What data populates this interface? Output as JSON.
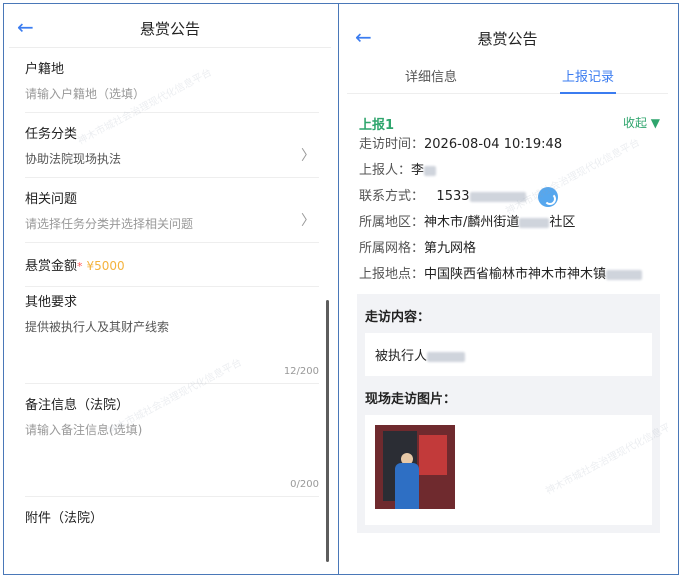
{
  "left": {
    "title": "悬赏公告",
    "fields": {
      "huji": {
        "label": "户籍地",
        "placeholder": "请输入户籍地（选填）"
      },
      "category": {
        "label": "任务分类",
        "value": "协助法院现场执法"
      },
      "issue": {
        "label": "相关问题",
        "placeholder": "请选择任务分类并选择相关问题"
      },
      "reward": {
        "label": "悬赏金额",
        "required": "*",
        "value": "¥5000"
      },
      "other": {
        "label": "其他要求",
        "value": "提供被执行人及其财产线索",
        "counter": "12/200"
      },
      "remark": {
        "label": "备注信息（法院）",
        "placeholder": "请输入备注信息(选填)",
        "counter": "0/200"
      },
      "attachment": {
        "label": "附件（法院）"
      }
    }
  },
  "right": {
    "title": "悬赏公告",
    "tabs": [
      "详细信息",
      "上报记录"
    ],
    "active_tab": 1,
    "report": {
      "title": "上报1",
      "collapse": "收起 ▼",
      "rows": [
        {
          "k": "走访时间：",
          "v": "2026-08-04 10:19:48"
        },
        {
          "k": "上报人：",
          "v": "李"
        },
        {
          "k": "联系方式：",
          "v": "1533"
        },
        {
          "k": "所属地区：",
          "v": "神木市/麟州街道",
          "v2": "社区"
        },
        {
          "k": "所属网格：",
          "v": "第九网格"
        },
        {
          "k": "上报地点：",
          "v": "中国陕西省榆林市神木市神木镇"
        }
      ],
      "visit_title": "走访内容：",
      "visit_content": "被执行人",
      "photos_title": "现场走访图片："
    }
  },
  "icons": {
    "back": "back-arrow-icon",
    "chevron": "chevron-right-icon",
    "call": "phone-call-icon"
  },
  "colors": {
    "accent": "#3b7cf0",
    "green": "#2fa56d",
    "money": "#f4b33e",
    "required": "#ff5a5a"
  }
}
